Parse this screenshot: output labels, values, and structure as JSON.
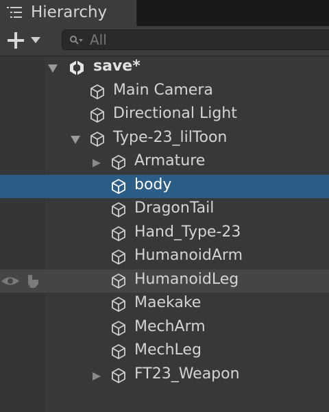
{
  "window": {
    "tab_label": "Hierarchy"
  },
  "toolbar": {
    "search_placeholder": "All"
  },
  "tree": {
    "scene": {
      "label": "save*"
    },
    "items": [
      {
        "label": "Main Camera"
      },
      {
        "label": "Directional Light"
      },
      {
        "label": "Type-23_lilToon"
      },
      {
        "label": "Armature"
      },
      {
        "label": "body"
      },
      {
        "label": "DragonTail"
      },
      {
        "label": "Hand_Type-23"
      },
      {
        "label": "HumanoidArm"
      },
      {
        "label": "HumanoidLeg"
      },
      {
        "label": "Maekake"
      },
      {
        "label": "MechArm"
      },
      {
        "label": "MechLeg"
      },
      {
        "label": "FT23_Weapon"
      }
    ]
  },
  "colors": {
    "selection": "#2c5d87",
    "panel": "#383838",
    "text": "#d2d2d2"
  }
}
